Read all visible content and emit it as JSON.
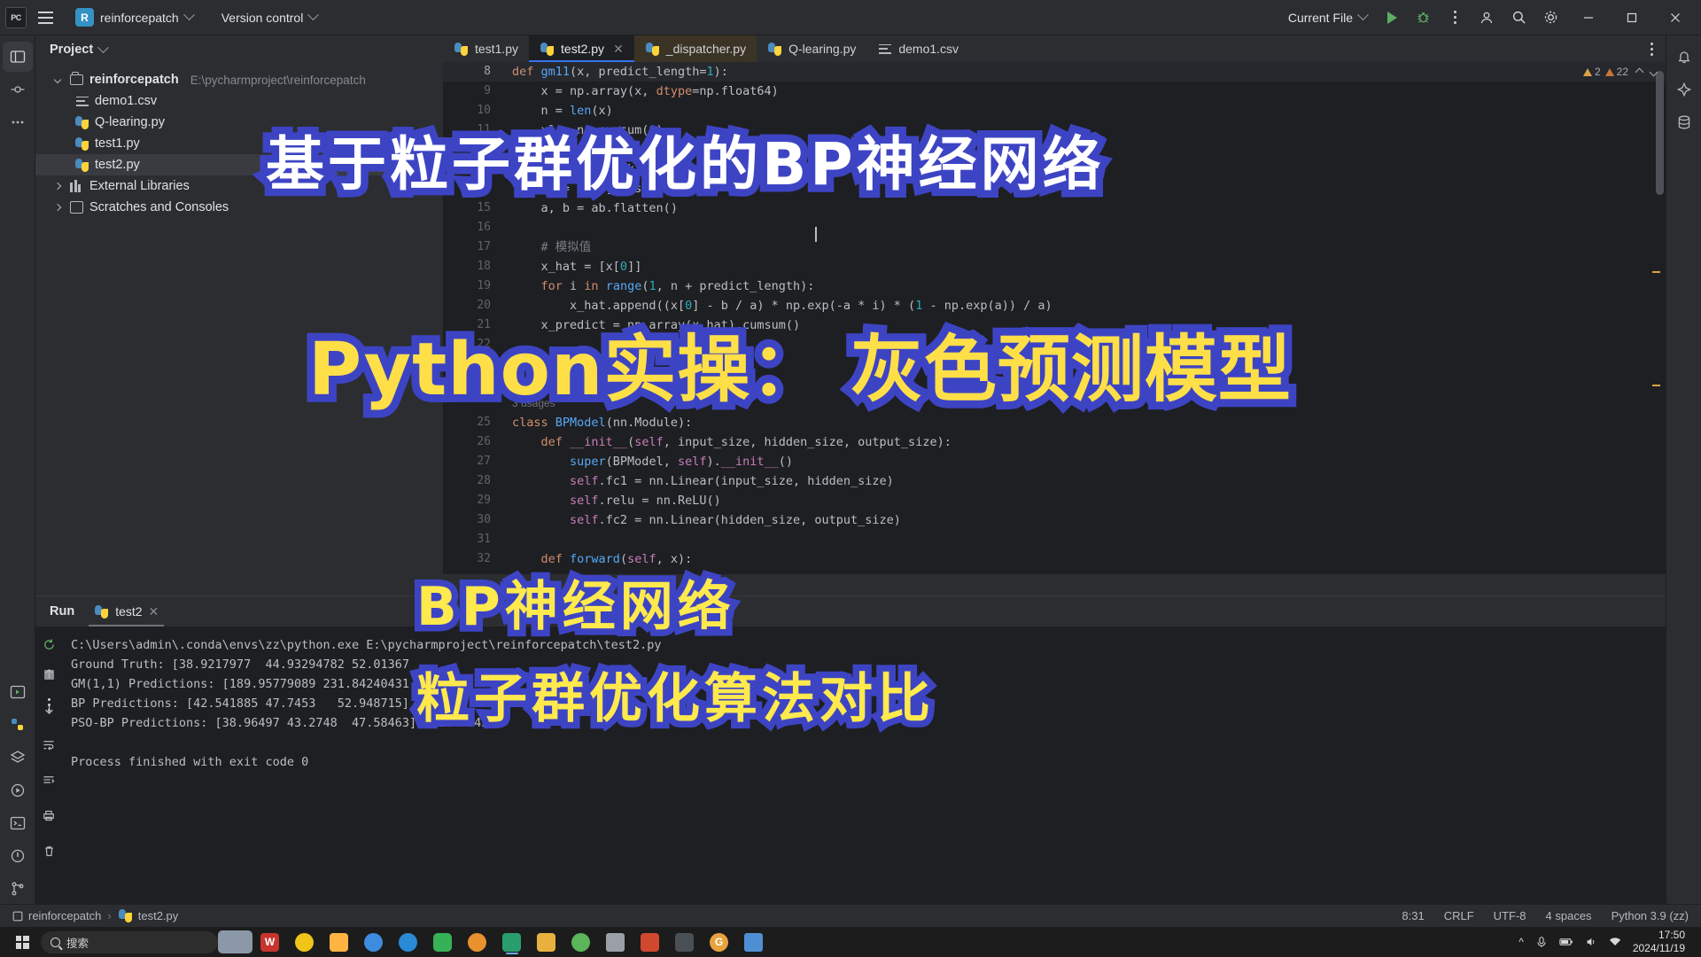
{
  "titlebar": {
    "logo_label": "PC",
    "project_badge": "R",
    "project_name": "reinforcepatch",
    "version_control": "Version control",
    "current_file": "Current File",
    "run_icon": "run-triangle-icon",
    "debug_icon": "debug-bug-icon",
    "more_icon": "more-vertical-icon",
    "minimize": "minimize-icon",
    "maximize": "maximize-icon",
    "close": "close-icon",
    "account_icon": "account-icon",
    "search_icon": "search-icon",
    "settings_icon": "settings-gear-icon"
  },
  "project_panel": {
    "title": "Project",
    "root": {
      "label": "reinforcepatch",
      "path": "E:\\pycharmproject\\reinforcepatch",
      "expanded": true
    },
    "files": [
      {
        "label": "demo1.csv",
        "icon": "csv-file-icon",
        "selected": false
      },
      {
        "label": "Q-learing.py",
        "icon": "python-file-icon",
        "selected": false
      },
      {
        "label": "test1.py",
        "icon": "python-file-icon",
        "selected": false
      },
      {
        "label": "test2.py",
        "icon": "python-file-icon",
        "selected": true
      }
    ],
    "nodes": [
      {
        "label": "External Libraries",
        "icon": "library-icon",
        "expanded": false
      },
      {
        "label": "Scratches and Consoles",
        "icon": "scratch-icon",
        "expanded": false
      }
    ]
  },
  "editor": {
    "tabs": [
      {
        "label": "test1.py",
        "icon": "python-file-icon",
        "active": false,
        "modified": false,
        "closable": false
      },
      {
        "label": "test2.py",
        "icon": "python-file-icon",
        "active": true,
        "modified": false,
        "closable": true
      },
      {
        "label": "_dispatcher.py",
        "icon": "python-file-icon",
        "active": false,
        "modified": true,
        "closable": false
      },
      {
        "label": "Q-learing.py",
        "icon": "python-file-icon",
        "active": false,
        "modified": false,
        "closable": false
      },
      {
        "label": "demo1.csv",
        "icon": "csv-file-icon",
        "active": false,
        "modified": false,
        "closable": false
      }
    ],
    "inspections": {
      "warnings": "2",
      "weak_warnings": "22"
    },
    "usage_hint": "3 usages",
    "lines": [
      {
        "n": "8",
        "indent": 0,
        "current": true,
        "tokens": [
          {
            "t": "def ",
            "c": "kw"
          },
          {
            "t": "gm11",
            "c": "decl"
          },
          {
            "t": "(x, predict_length=",
            "c": "cls"
          },
          {
            "t": "1",
            "c": "num"
          },
          {
            "t": "):",
            "c": "cls"
          }
        ]
      },
      {
        "n": "9",
        "indent": 1,
        "current": false,
        "tokens": [
          {
            "t": "x = np.array(x, ",
            "c": "cls"
          },
          {
            "t": "dtype",
            "c": "kw"
          },
          {
            "t": "=np.float64)",
            "c": "cls"
          }
        ]
      },
      {
        "n": "10",
        "indent": 1,
        "current": false,
        "tokens": [
          {
            "t": "n = ",
            "c": "cls"
          },
          {
            "t": "len",
            "c": "fn"
          },
          {
            "t": "(x)",
            "c": "cls"
          }
        ]
      },
      {
        "n": "11",
        "indent": 1,
        "current": false,
        "tokens": [
          {
            "t": "x1 = np.cumsum(x)",
            "c": "cls"
          }
        ]
      },
      {
        "n": "12",
        "indent": 1,
        "current": false,
        "tokens": [
          {
            "t": "z1 = (x1[:-",
            "c": "cls"
          },
          {
            "t": "1",
            "c": "num"
          },
          {
            "t": "] + x1[",
            "c": "cls"
          },
          {
            "t": "1",
            "c": "num"
          },
          {
            "t": ":]) / ",
            "c": "cls"
          },
          {
            "t": "2.0",
            "c": "num"
          }
        ]
      },
      {
        "n": "13",
        "indent": 1,
        "current": false,
        "tokens": [
          {
            "t": "B = np.vstack([-z1, np.ones_like(z1)]).T",
            "c": "cls"
          }
        ]
      },
      {
        "n": "14",
        "indent": 1,
        "current": false,
        "tokens": [
          {
            "t": "Yn = x[",
            "c": "cls"
          },
          {
            "t": "1",
            "c": "num"
          },
          {
            "t": ":].reshape(-",
            "c": "cls"
          },
          {
            "t": "1",
            "c": "num"
          },
          {
            "t": ", ",
            "c": "cls"
          },
          {
            "t": "1",
            "c": "num"
          },
          {
            "t": ")",
            "c": "cls"
          }
        ]
      },
      {
        "n": "15",
        "indent": 1,
        "current": false,
        "tokens": [
          {
            "t": "a, b = ab.flatten()",
            "c": "cls"
          }
        ]
      },
      {
        "n": "16",
        "indent": 1,
        "current": false,
        "tokens": []
      },
      {
        "n": "17",
        "indent": 1,
        "current": false,
        "tokens": [
          {
            "t": "# 模拟值",
            "c": "cmt"
          }
        ]
      },
      {
        "n": "18",
        "indent": 1,
        "current": false,
        "tokens": [
          {
            "t": "x_hat = [x[",
            "c": "cls"
          },
          {
            "t": "0",
            "c": "num"
          },
          {
            "t": "]]",
            "c": "cls"
          }
        ]
      },
      {
        "n": "19",
        "indent": 1,
        "current": false,
        "tokens": [
          {
            "t": "for",
            "c": "kw"
          },
          {
            "t": " i ",
            "c": "cls"
          },
          {
            "t": "in",
            "c": "kw"
          },
          {
            "t": " ",
            "c": "cls"
          },
          {
            "t": "range",
            "c": "fn"
          },
          {
            "t": "(",
            "c": "cls"
          },
          {
            "t": "1",
            "c": "num"
          },
          {
            "t": ", n + predict_length):",
            "c": "cls"
          }
        ]
      },
      {
        "n": "20",
        "indent": 2,
        "current": false,
        "tokens": [
          {
            "t": "x_hat.append((x[",
            "c": "cls"
          },
          {
            "t": "0",
            "c": "num"
          },
          {
            "t": "] - b / a) * np.exp(-a * i) * (",
            "c": "cls"
          },
          {
            "t": "1",
            "c": "num"
          },
          {
            "t": " - np.exp(a)) / a)",
            "c": "cls"
          }
        ]
      },
      {
        "n": "21",
        "indent": 1,
        "current": false,
        "tokens": [
          {
            "t": "x_predict = np.array(x_hat).cumsum()",
            "c": "cls"
          }
        ]
      },
      {
        "n": "22",
        "indent": 1,
        "current": false,
        "tokens": []
      },
      {
        "n": "23",
        "indent": 1,
        "current": false,
        "tokens": []
      },
      {
        "n": "24",
        "indent": 0,
        "current": false,
        "tokens": []
      },
      {
        "n": "25",
        "indent": 0,
        "current": false,
        "hint": "3 usages",
        "tokens": [
          {
            "t": "class ",
            "c": "kw"
          },
          {
            "t": "BPModel",
            "c": "decl"
          },
          {
            "t": "(nn.Module):",
            "c": "cls"
          }
        ]
      },
      {
        "n": "26",
        "indent": 1,
        "current": false,
        "tokens": [
          {
            "t": "def ",
            "c": "kw"
          },
          {
            "t": "__init__",
            "c": "magenta"
          },
          {
            "t": "(",
            "c": "cls"
          },
          {
            "t": "self",
            "c": "selfkw"
          },
          {
            "t": ", input_size, hidden_size, output_size):",
            "c": "cls"
          }
        ]
      },
      {
        "n": "27",
        "indent": 2,
        "current": false,
        "tokens": [
          {
            "t": "super",
            "c": "fn"
          },
          {
            "t": "(BPModel, ",
            "c": "cls"
          },
          {
            "t": "self",
            "c": "selfkw"
          },
          {
            "t": ").",
            "c": "cls"
          },
          {
            "t": "__init__",
            "c": "magenta"
          },
          {
            "t": "()",
            "c": "cls"
          }
        ]
      },
      {
        "n": "28",
        "indent": 2,
        "current": false,
        "tokens": [
          {
            "t": "self",
            "c": "selfkw"
          },
          {
            "t": ".fc1 = nn.Linear(input_size, hidden_size)",
            "c": "cls"
          }
        ]
      },
      {
        "n": "29",
        "indent": 2,
        "current": false,
        "tokens": [
          {
            "t": "self",
            "c": "selfkw"
          },
          {
            "t": ".relu = nn.ReLU()",
            "c": "cls"
          }
        ]
      },
      {
        "n": "30",
        "indent": 2,
        "current": false,
        "tokens": [
          {
            "t": "self",
            "c": "selfkw"
          },
          {
            "t": ".fc2 = nn.Linear(hidden_size, output_size)",
            "c": "cls"
          }
        ]
      },
      {
        "n": "31",
        "indent": 2,
        "current": false,
        "tokens": []
      },
      {
        "n": "32",
        "indent": 1,
        "current": false,
        "tokens": [
          {
            "t": "def ",
            "c": "kw"
          },
          {
            "t": "forward",
            "c": "decl"
          },
          {
            "t": "(",
            "c": "cls"
          },
          {
            "t": "self",
            "c": "selfkw"
          },
          {
            "t": ", x):",
            "c": "cls"
          }
        ]
      }
    ]
  },
  "run_panel": {
    "title": "Run",
    "tab_label": "test2",
    "tab_icon": "python-file-icon",
    "toolbar": [
      {
        "name": "rerun-button",
        "icon": "rerun-icon"
      },
      {
        "name": "stop-button",
        "icon": "stop-icon"
      },
      {
        "name": "more-button",
        "icon": "more-vertical-icon"
      }
    ],
    "side_tools": [
      {
        "name": "scroll-up-button",
        "icon": "arrow-up-icon"
      },
      {
        "name": "scroll-down-button",
        "icon": "arrow-down-icon"
      },
      {
        "name": "soft-wrap-button",
        "icon": "wrap-icon"
      },
      {
        "name": "scroll-to-end-button",
        "icon": "scroll-end-icon"
      },
      {
        "name": "print-button",
        "icon": "printer-icon"
      },
      {
        "name": "clear-button",
        "icon": "trash-icon"
      }
    ],
    "output": [
      "C:\\Users\\admin\\.conda\\envs\\zz\\python.exe E:\\pycharmproject\\reinforcepatch\\test2.py",
      "Ground Truth: [38.9217977  44.93294782 52.01367",
      "GM(1,1) Predictions: [189.95779089 231.84240431",
      "BP Predictions: [42.541885 47.7453   52.948715]",
      "PSO-BP Predictions: [38.96497 43.2748  47.58463] MSE: 7.4559",
      "",
      "Process finished with exit code 0"
    ]
  },
  "statusbar": {
    "breadcrumb": [
      "reinforcepatch",
      "test2.py"
    ],
    "caret": "8:31",
    "line_sep": "CRLF",
    "encoding": "UTF-8",
    "indent": "4 spaces",
    "interpreter": "Python 3.9 (zz)"
  },
  "taskbar": {
    "search_placeholder": "搜索",
    "clock_time": "17:50",
    "clock_date": "2024/11/19",
    "apps": [
      {
        "name": "taskbar-app-wps",
        "color": "#c8342e",
        "label": "W"
      },
      {
        "name": "taskbar-app-browser",
        "color": "#f0c419",
        "label": ""
      },
      {
        "name": "taskbar-app-explorer",
        "color": "#ffb441",
        "label": ""
      },
      {
        "name": "taskbar-app-cloud",
        "color": "#3d8ce0",
        "label": ""
      },
      {
        "name": "taskbar-app-edge",
        "color": "#2b8ad6",
        "label": ""
      },
      {
        "name": "taskbar-app-chat",
        "color": "#36b158",
        "label": ""
      },
      {
        "name": "taskbar-app-pycharm",
        "color": "#2a9d6e",
        "label": "",
        "running": true
      },
      {
        "name": "taskbar-app-pen",
        "color": "#e8b13f",
        "label": ""
      },
      {
        "name": "taskbar-app-leaf",
        "color": "#5bb55b",
        "label": ""
      },
      {
        "name": "taskbar-app-doc",
        "color": "#9aa0a6",
        "label": ""
      },
      {
        "name": "taskbar-app-media",
        "color": "#d0482e",
        "label": ""
      },
      {
        "name": "taskbar-app-g",
        "color": "#e8a33f",
        "label": "G"
      },
      {
        "name": "taskbar-app-photos",
        "color": "#4e8fd4",
        "label": ""
      }
    ],
    "tray": [
      {
        "name": "tray-chevron-icon"
      },
      {
        "name": "tray-mic-icon"
      },
      {
        "name": "tray-battery-icon"
      },
      {
        "name": "tray-volume-icon"
      },
      {
        "name": "tray-network-icon"
      }
    ]
  },
  "overlay": {
    "line1": "基于粒子群优化的BP神经网络",
    "line2": "Python实操： 灰色预测模型",
    "line3": "BP神经网络",
    "line4": "粒子群优化算法对比",
    "stroke_color": "#3d44c4",
    "line1_fill": "#ffffff",
    "line2_fill": "#ffdf47",
    "line3_fill": "#ffe94d",
    "line4_fill": "#ffe94d"
  }
}
